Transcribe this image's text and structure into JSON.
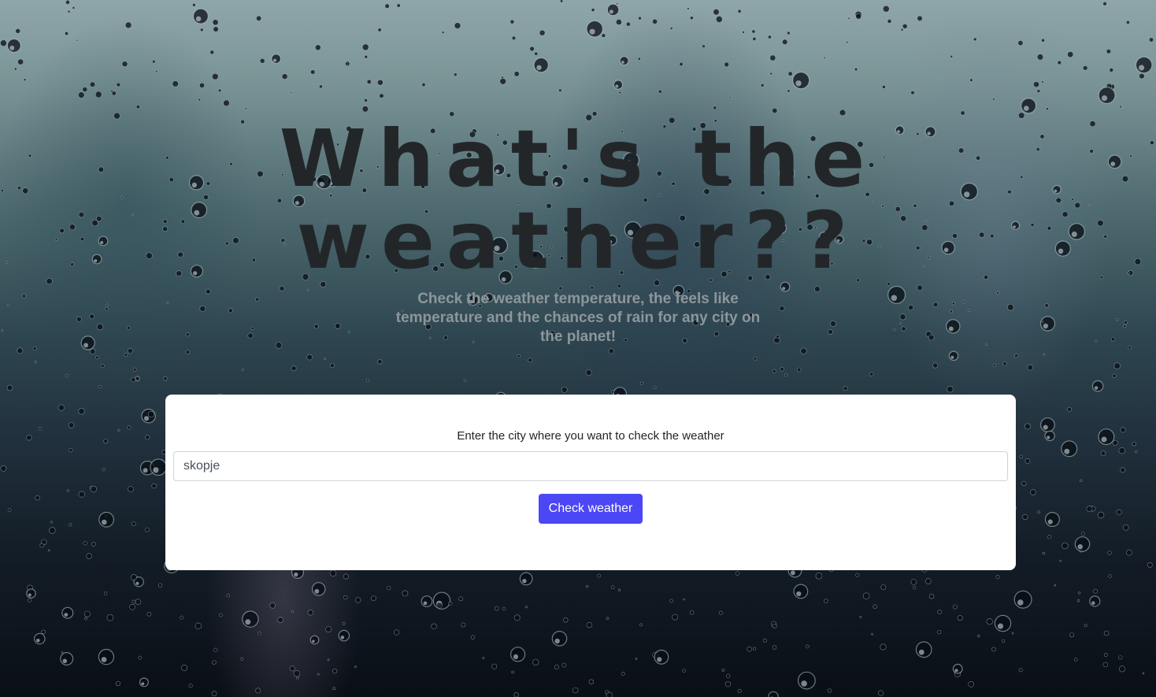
{
  "hero": {
    "title_line1": "What's the",
    "title_line2": "weather??",
    "subtitle": "Check the weather temperature, the feels like temperature and the chances of rain for any city on the planet!"
  },
  "form": {
    "label": "Enter the city where you want to check the weather",
    "city_value": "skopje",
    "button_label": "Check weather"
  },
  "colors": {
    "accent": "#4b47f5",
    "title": "#232629",
    "subtitle": "#8d969b"
  }
}
